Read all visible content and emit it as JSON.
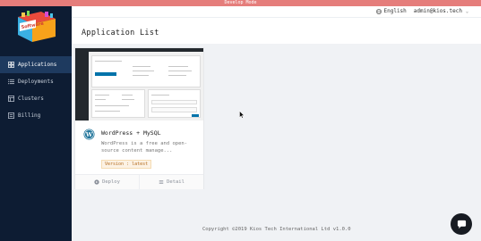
{
  "banner": {
    "text": "Develop Mode"
  },
  "logo": {
    "text": "Software"
  },
  "header": {
    "language": "English",
    "user": "admin@kios.tech"
  },
  "sidebar": {
    "items": [
      {
        "label": "Applications",
        "icon": "grid-icon",
        "active": true
      },
      {
        "label": "Deployments",
        "icon": "list-icon",
        "active": false
      },
      {
        "label": "Clusters",
        "icon": "cluster-icon",
        "active": false
      },
      {
        "label": "Billing",
        "icon": "billing-icon",
        "active": false
      }
    ]
  },
  "page": {
    "title": "Application List"
  },
  "apps": [
    {
      "name": "WordPress + MySQL",
      "description": "WordPress is a free and open-source content manage...",
      "version": "Version : latest",
      "actions": {
        "deploy": "Deploy",
        "detail": "Detail"
      }
    }
  ],
  "footer": {
    "text": "Copyright ©2019 Kios Tech International Ltd v1.0.0"
  },
  "colors": {
    "sidebar_bg": "#0d1c33",
    "sidebar_active": "#1e3a5f",
    "banner": "#e57d7b"
  }
}
